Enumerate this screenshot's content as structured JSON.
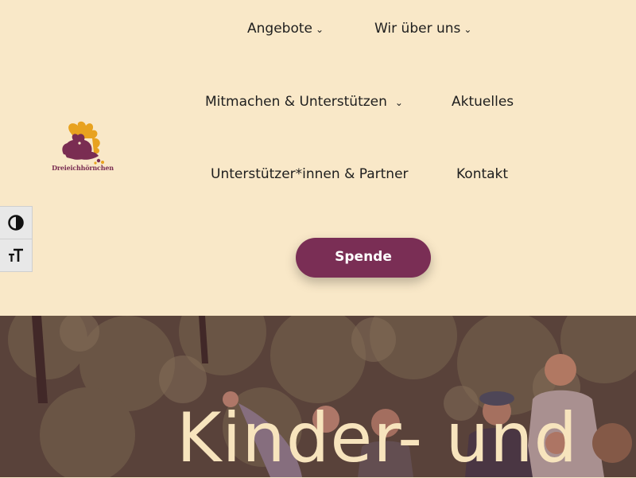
{
  "logo": {
    "text": "Dreieichhörnchen"
  },
  "nav": {
    "items": [
      {
        "label": "Angebote",
        "has_dropdown": true
      },
      {
        "label": "Wir über uns",
        "has_dropdown": true
      },
      {
        "label": "Mitmachen & Unterstützen",
        "has_dropdown": true
      },
      {
        "label": "Aktuelles",
        "has_dropdown": false
      },
      {
        "label": "Unterstützer*innen & Partner",
        "has_dropdown": false
      },
      {
        "label": "Kontakt",
        "has_dropdown": false
      }
    ],
    "chevron": "⌄"
  },
  "donate": {
    "label": "Spende"
  },
  "accessibility": {
    "contrast_icon": "contrast-icon",
    "font_size_icon": "font-size-icon"
  },
  "hero": {
    "title": "Kinder- und"
  },
  "colors": {
    "background": "#f9e8c8",
    "brand": "#7a2e55",
    "accent": "#e8a21f",
    "hero_text": "#f7e4bd"
  }
}
